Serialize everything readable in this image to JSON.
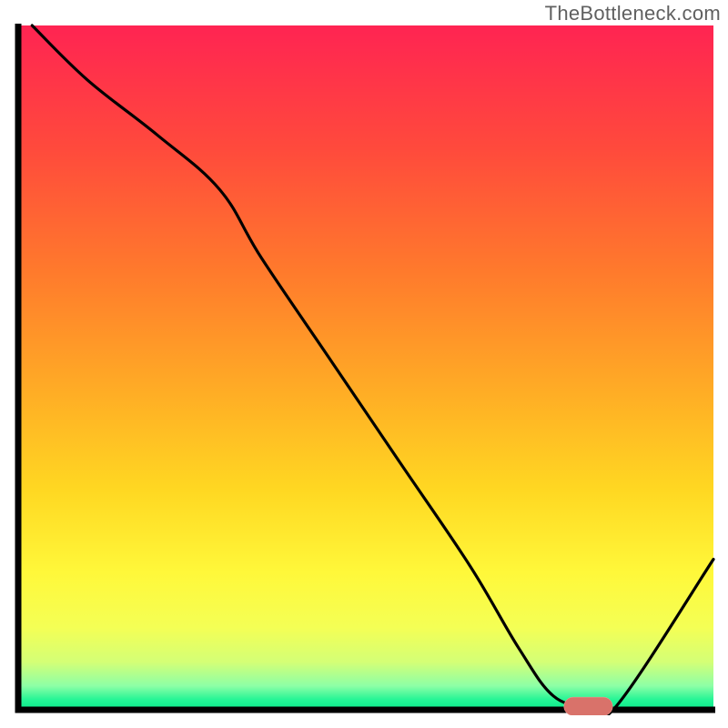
{
  "watermark": "TheBottleneck.com",
  "colors": {
    "axis": "#000000",
    "curve": "#000000",
    "marker_fill": "#d9726a",
    "marker_outline": "#f3a19b",
    "gradient_stops": [
      {
        "offset": 0.0,
        "color": "#ff2452"
      },
      {
        "offset": 0.18,
        "color": "#ff4a3c"
      },
      {
        "offset": 0.36,
        "color": "#ff7a2c"
      },
      {
        "offset": 0.54,
        "color": "#ffae25"
      },
      {
        "offset": 0.68,
        "color": "#ffd822"
      },
      {
        "offset": 0.8,
        "color": "#fff83a"
      },
      {
        "offset": 0.88,
        "color": "#f4ff55"
      },
      {
        "offset": 0.93,
        "color": "#d4ff76"
      },
      {
        "offset": 0.965,
        "color": "#8dffa6"
      },
      {
        "offset": 0.985,
        "color": "#26f596"
      },
      {
        "offset": 1.0,
        "color": "#07e98b"
      }
    ]
  },
  "chart_data": {
    "type": "line",
    "title": "",
    "xlabel": "",
    "ylabel": "",
    "xlim": [
      0,
      100
    ],
    "ylim": [
      0,
      100
    ],
    "x": [
      2,
      10,
      20,
      29,
      35,
      45,
      55,
      65,
      72,
      77,
      82,
      86,
      100
    ],
    "y": [
      100,
      92,
      84,
      76,
      66,
      51,
      36,
      21,
      9,
      2,
      0.5,
      0.5,
      22
    ],
    "flat_segment_x": [
      78,
      86
    ],
    "marker": {
      "x_center": 82,
      "width": 7,
      "height": 2.7,
      "rx": 1.35
    }
  }
}
